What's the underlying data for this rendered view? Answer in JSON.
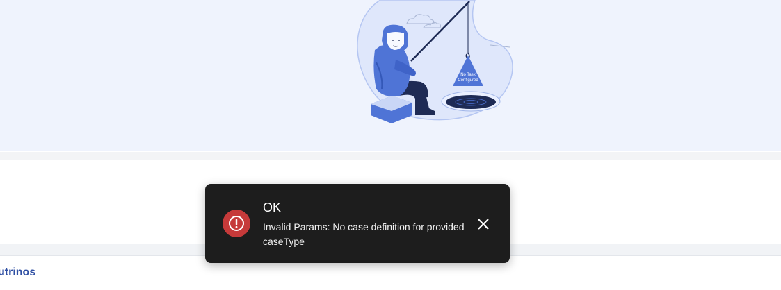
{
  "empty_state": {
    "illustration_caption_line1": "No Task",
    "illustration_caption_line2": "Configured"
  },
  "toast": {
    "status": "error",
    "title": "OK",
    "message": "Invalid Params: No case definition for provided caseType",
    "icon": "alert-circle-icon",
    "close_icon": "close-icon",
    "accent_color": "#c63a3a",
    "background_color": "#1d1d1d"
  },
  "bottom": {
    "link_text": "utrinos",
    "link_color": "#2f4fa3"
  },
  "colors": {
    "panel_background": "#eff3fd",
    "illustration_blue": "#4f74d6"
  }
}
